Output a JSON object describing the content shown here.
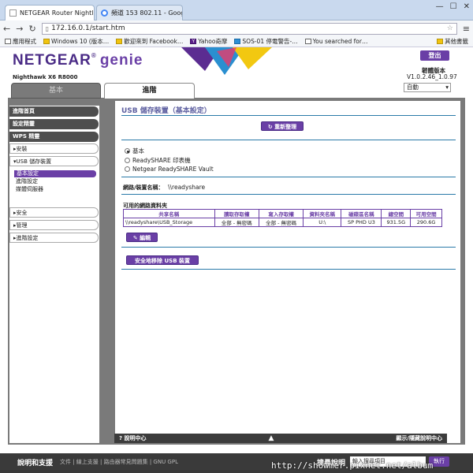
{
  "browser": {
    "tabs": [
      {
        "title": "NETGEAR Router Nightl"
      },
      {
        "title": "頻道 153 802.11 - Googl"
      }
    ],
    "url": "172.16.0.1/start.htm",
    "bookmarks": [
      "應用程式",
      "Windows 10 (版本…",
      "歡迎來到 Facebook…",
      "Yahoo奇摩",
      "SOS-01 停電警告-…",
      "You searched for…",
      "其他書籤"
    ]
  },
  "header": {
    "logo_main": "NETGEAR",
    "logo_genie": "genie",
    "logo_r": "®",
    "model": "Nighthawk X6 R8000",
    "logout": "登出",
    "fw_title": "韌體版本",
    "fw_version": "V1.0.2.46_1.0.97",
    "auto_select": "自動"
  },
  "main_tabs": {
    "basic": "基本",
    "advanced": "進階"
  },
  "sidebar": {
    "home": "進階首頁",
    "setup_wizard": "設定精靈",
    "wps_wizard": "WPS 精靈",
    "setup": "▸安裝",
    "usb_storage": "▾USB 儲存裝置",
    "sub_basic": "基本設定",
    "sub_advanced": "進階設定",
    "sub_media": "媒體伺服器",
    "security": "▸安全",
    "admin": "▸管理",
    "adv_setup": "▸進階設定"
  },
  "content": {
    "title": "USB 儲存裝置（基本設定）",
    "refresh": "重新整理",
    "radio_options": [
      "基本",
      "ReadySHARE 印表機",
      "Netgear ReadySHARE Vault"
    ],
    "device_name_label": "網路/裝置名稱：",
    "device_name_value": "\\\\readyshare",
    "folders_title": "可用的網路資料夾",
    "table_headers": [
      "共享名稱",
      "讀取存取權",
      "寫入存取權",
      "資料夾名稱",
      "磁碟區名稱",
      "總空間",
      "可用空間"
    ],
    "table_rows": [
      [
        "\\\\readyshare\\USB_Storage",
        "全部 - 無密碼",
        "全部 - 無密碼",
        "U:\\",
        "SP PHD U3",
        "931.5G",
        "290.6G"
      ]
    ],
    "edit_button": "編輯",
    "safe_remove": "安全地移除 USB 裝置"
  },
  "help": {
    "left": "說明中心",
    "right": "顯示/隱藏說明中心"
  },
  "footer": {
    "label": "說明和支援",
    "links": "文件 | 線上支援 | 路由器常見問題集 | GNU GPL",
    "search_label": "搜尋說明",
    "search_placeholder": "輸入搜尋項目",
    "go": "執行"
  },
  "watermark": "http://showmer.pixnet.net/album",
  "colors": {
    "brand_purple": "#6a3fa6",
    "frame_gray": "#7a7a7a",
    "rule_blue": "#2a7aa8"
  }
}
